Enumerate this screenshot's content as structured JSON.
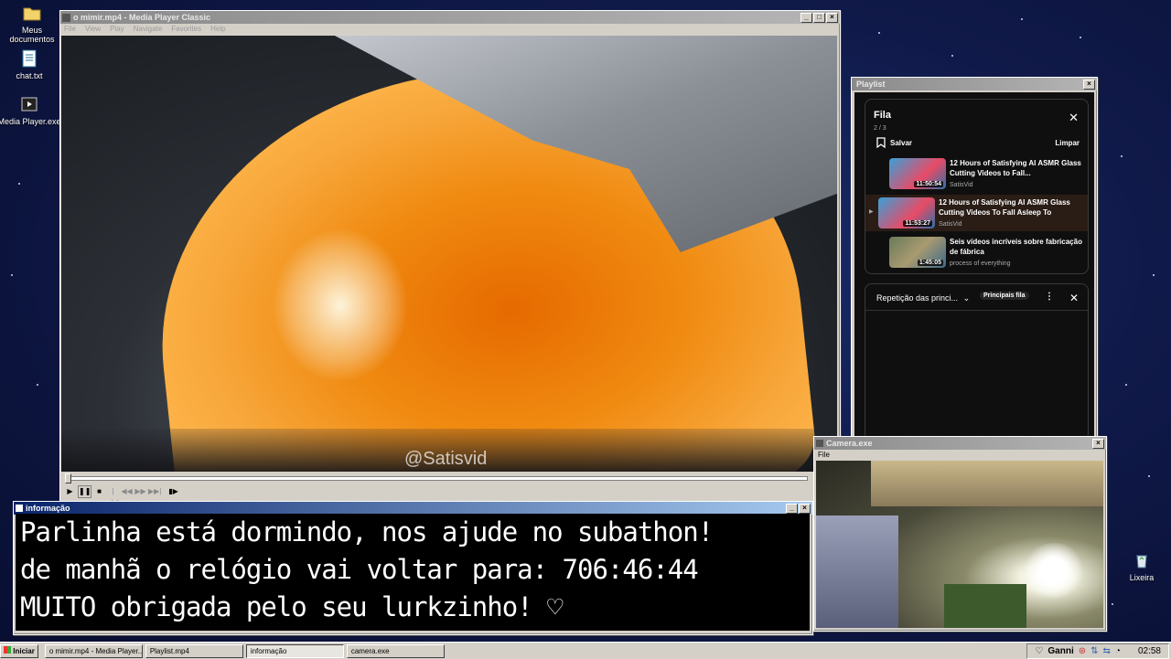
{
  "desktop": {
    "icons": [
      {
        "label": "Meus documentos",
        "icon": "folder-icon"
      },
      {
        "label": "chat.txt",
        "icon": "notepad-icon"
      },
      {
        "label": "Media Player.exe",
        "icon": "media-player-icon"
      },
      {
        "label": "Lixeira",
        "icon": "recycle-bin-icon"
      }
    ]
  },
  "player": {
    "title": "o mimir.mp4 - Media Player Classic",
    "menu": [
      "File",
      "View",
      "Play",
      "Navigate",
      "Favorites",
      "Help"
    ],
    "watermark": "@Satisvid",
    "progress": 0.0
  },
  "playlist_window": {
    "title": "Playlist",
    "header": "Fila",
    "position": "2 / 3",
    "save_label": "Salvar",
    "clear_label": "Limpar",
    "items": [
      {
        "title": "12 Hours of Satisfying AI ASMR Glass Cutting Videos to Fall...",
        "channel": "SatisVid",
        "duration": "11:50:54",
        "active": false
      },
      {
        "title": "12 Hours of Satisfying AI ASMR Glass Cutting Videos To Fall Asleep To",
        "channel": "SatisVid",
        "duration": "11:53:27",
        "active": true
      },
      {
        "title": "Seis vídeos incríveis sobre fabricação de fábrica",
        "channel": "process of everything",
        "duration": "1:45:05",
        "active": false
      }
    ],
    "mix_label": "Repetição das princi...",
    "mix_badge": "Principais fila"
  },
  "info_window": {
    "title": "informação",
    "lines": [
      "Parlinha está dormindo, nos ajude no subathon!",
      "de manhã o relógio vai voltar para:  706:46:44",
      "MUITO obrigada pelo seu lurkzinho! ♡"
    ]
  },
  "camera_window": {
    "title": "Camera.exe",
    "menu": [
      "File"
    ]
  },
  "taskbar": {
    "start_label": "Iniciar",
    "tasks": [
      {
        "label": "o mimir.mp4 - Media Player...",
        "pressed": false
      },
      {
        "label": "Playlist.mp4",
        "pressed": false
      },
      {
        "label": "informação",
        "pressed": true
      },
      {
        "label": "camera.exe",
        "pressed": false
      }
    ],
    "tray_user": "Ganni",
    "clock": "02:58"
  }
}
